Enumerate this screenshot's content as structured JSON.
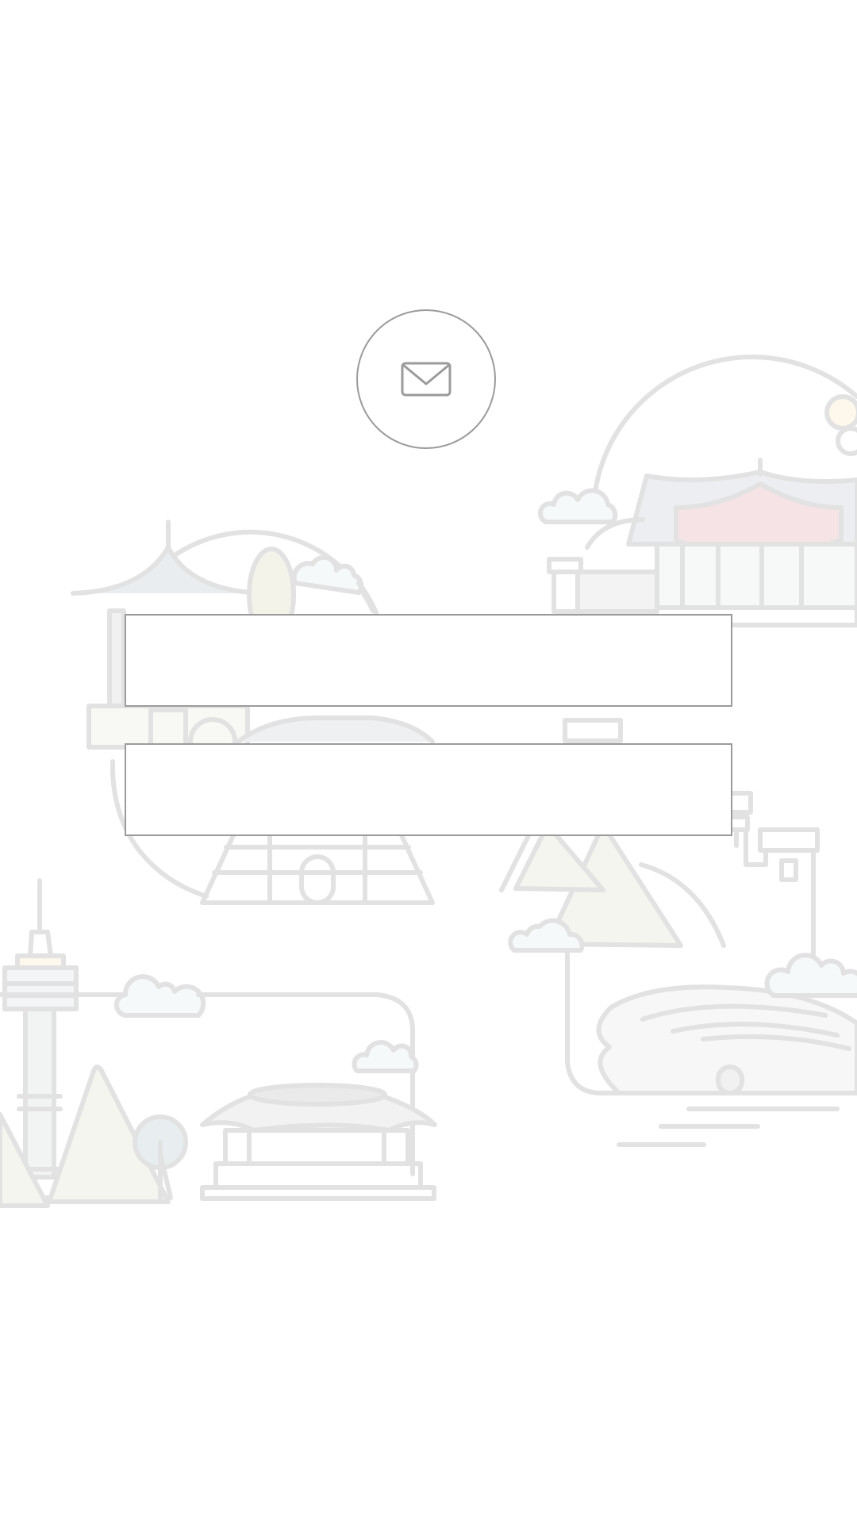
{
  "screen": {
    "background_color": "#ffffff",
    "illustration": "city-landmarks-line-art",
    "icon": "envelope-icon"
  },
  "form": {
    "field_1": {
      "value": "",
      "placeholder": ""
    },
    "field_2": {
      "value": "",
      "placeholder": ""
    }
  },
  "colors": {
    "outline": "#9b9b9b",
    "illustration_line": "#e2e2e2",
    "roof_accent": "#f6e3e6"
  }
}
